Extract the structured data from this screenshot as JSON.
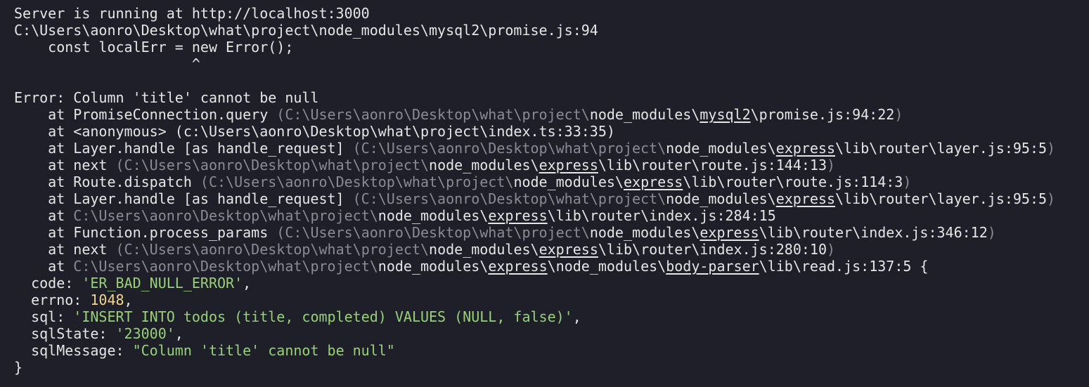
{
  "terminal": {
    "colors": {
      "background": "#1e1f29",
      "text": "#e6e6e6",
      "dim": "#8a8c94",
      "string": "#98d17a",
      "number": "#f2d48c"
    },
    "lines": [
      [
        {
          "t": "Server is running at http://localhost:3000"
        }
      ],
      [
        {
          "t": "C:\\Users\\aonro\\Desktop\\what\\project\\node_modules\\mysql2\\promise.js:94"
        }
      ],
      [
        {
          "t": "    const localErr = new Error();"
        }
      ],
      [
        {
          "t": "                     ^"
        }
      ],
      [
        {
          "t": ""
        }
      ],
      [
        {
          "t": "Error: Column 'title' cannot be null"
        }
      ],
      [
        {
          "t": "    at PromiseConnection.query "
        },
        {
          "t": "(C:\\Users\\aonro\\Desktop\\what\\project\\",
          "c": "dim"
        },
        {
          "t": "node_modules\\"
        },
        {
          "t": "mysql2",
          "c": "u"
        },
        {
          "t": "\\promise.js:94:22"
        },
        {
          "t": ")",
          "c": "dim"
        }
      ],
      [
        {
          "t": "    at <anonymous> (c:\\Users\\aonro\\Desktop\\what\\project\\index.ts:33:35)"
        }
      ],
      [
        {
          "t": "    at Layer.handle [as handle_request] "
        },
        {
          "t": "(C:\\Users\\aonro\\Desktop\\what\\project\\",
          "c": "dim"
        },
        {
          "t": "node_modules\\"
        },
        {
          "t": "express",
          "c": "u"
        },
        {
          "t": "\\lib\\router\\layer.js:95:5"
        },
        {
          "t": ")",
          "c": "dim"
        }
      ],
      [
        {
          "t": "    at next "
        },
        {
          "t": "(C:\\Users\\aonro\\Desktop\\what\\project\\",
          "c": "dim"
        },
        {
          "t": "node_modules\\"
        },
        {
          "t": "express",
          "c": "u"
        },
        {
          "t": "\\lib\\router\\route.js:144:13"
        },
        {
          "t": ")",
          "c": "dim"
        }
      ],
      [
        {
          "t": "    at Route.dispatch "
        },
        {
          "t": "(C:\\Users\\aonro\\Desktop\\what\\project\\",
          "c": "dim"
        },
        {
          "t": "node_modules\\"
        },
        {
          "t": "express",
          "c": "u"
        },
        {
          "t": "\\lib\\router\\route.js:114:3"
        },
        {
          "t": ")",
          "c": "dim"
        }
      ],
      [
        {
          "t": "    at Layer.handle [as handle_request] "
        },
        {
          "t": "(C:\\Users\\aonro\\Desktop\\what\\project\\",
          "c": "dim"
        },
        {
          "t": "node_modules\\"
        },
        {
          "t": "express",
          "c": "u"
        },
        {
          "t": "\\lib\\router\\layer.js:95:5"
        },
        {
          "t": ")",
          "c": "dim"
        }
      ],
      [
        {
          "t": "    at "
        },
        {
          "t": "C:\\Users\\aonro\\Desktop\\what\\project\\",
          "c": "dim"
        },
        {
          "t": "node_modules\\"
        },
        {
          "t": "express",
          "c": "u"
        },
        {
          "t": "\\lib\\router\\index.js:284:15"
        }
      ],
      [
        {
          "t": "    at Function.process_params "
        },
        {
          "t": "(C:\\Users\\aonro\\Desktop\\what\\project\\",
          "c": "dim"
        },
        {
          "t": "node_modules\\"
        },
        {
          "t": "express",
          "c": "u"
        },
        {
          "t": "\\lib\\router\\index.js:346:12"
        },
        {
          "t": ")",
          "c": "dim"
        }
      ],
      [
        {
          "t": "    at next "
        },
        {
          "t": "(C:\\Users\\aonro\\Desktop\\what\\project\\",
          "c": "dim"
        },
        {
          "t": "node_modules\\"
        },
        {
          "t": "express",
          "c": "u"
        },
        {
          "t": "\\lib\\router\\index.js:280:10"
        },
        {
          "t": ")",
          "c": "dim"
        }
      ],
      [
        {
          "t": "    at "
        },
        {
          "t": "C:\\Users\\aonro\\Desktop\\what\\project\\",
          "c": "dim"
        },
        {
          "t": "node_modules\\"
        },
        {
          "t": "express",
          "c": "u"
        },
        {
          "t": "\\node_modules\\"
        },
        {
          "t": "body-parser",
          "c": "u"
        },
        {
          "t": "\\lib\\read.js:137:5 {"
        }
      ],
      [
        {
          "t": "  code: "
        },
        {
          "t": "'ER_BAD_NULL_ERROR'",
          "c": "str"
        },
        {
          "t": ","
        }
      ],
      [
        {
          "t": "  errno: "
        },
        {
          "t": "1048",
          "c": "num"
        },
        {
          "t": ","
        }
      ],
      [
        {
          "t": "  sql: "
        },
        {
          "t": "'INSERT INTO todos (title, completed) VALUES (NULL, false)'",
          "c": "str"
        },
        {
          "t": ","
        }
      ],
      [
        {
          "t": "  sqlState: "
        },
        {
          "t": "'23000'",
          "c": "str"
        },
        {
          "t": ","
        }
      ],
      [
        {
          "t": "  sqlMessage: "
        },
        {
          "t": "\"Column 'title' cannot be null\"",
          "c": "str"
        }
      ],
      [
        {
          "t": "}"
        }
      ]
    ]
  }
}
